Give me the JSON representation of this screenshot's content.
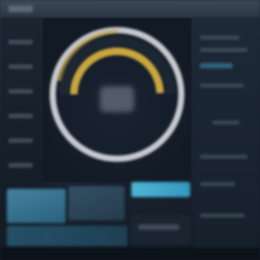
{
  "dashboard": {
    "gauge": {
      "accent_color": "#c9a640",
      "ring_color": "#d9dde2",
      "level_fraction": 0.55
    },
    "accent_color": "#4fb6d4"
  }
}
